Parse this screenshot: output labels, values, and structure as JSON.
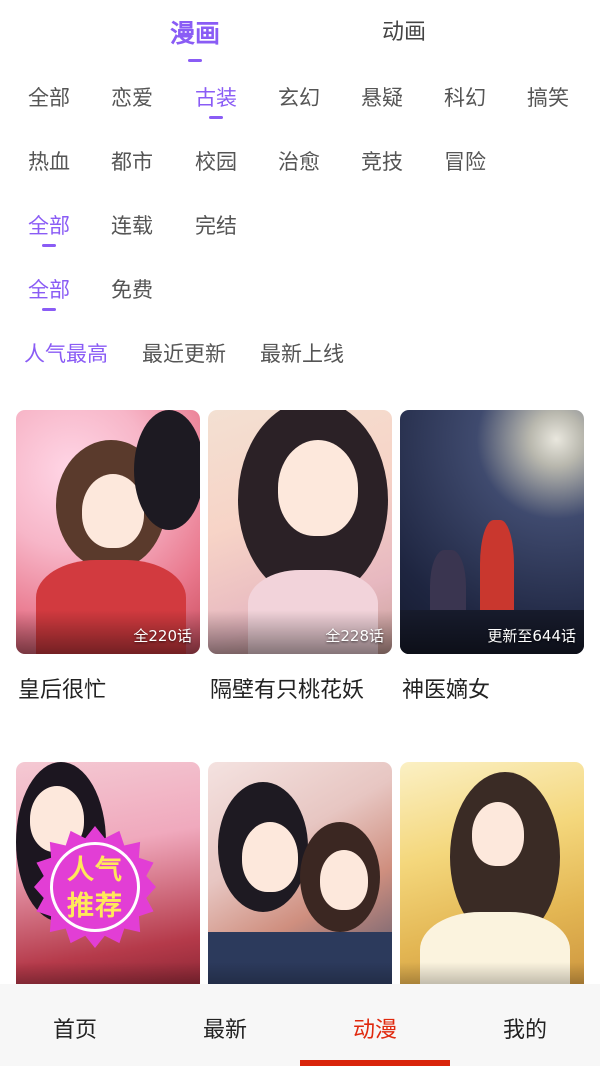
{
  "top_tabs": [
    {
      "label": "漫画",
      "active": true
    },
    {
      "label": "动画",
      "active": false
    }
  ],
  "genres_row1": [
    "全部",
    "恋爱",
    "古装",
    "玄幻",
    "悬疑",
    "科幻",
    "搞笑"
  ],
  "genres_row2": [
    "热血",
    "都市",
    "校园",
    "治愈",
    "竞技",
    "冒险"
  ],
  "status_filters": [
    "全部",
    "连载",
    "完结"
  ],
  "price_filters": [
    "全部",
    "免费"
  ],
  "sort_options": [
    "人气最高",
    "最近更新",
    "最新上线"
  ],
  "comics": [
    {
      "title": "皇后很忙",
      "episodes": "全220话"
    },
    {
      "title": "隔壁有只桃花妖",
      "episodes": "全228话"
    },
    {
      "title": "神医嫡女",
      "episodes": "更新至644话"
    }
  ],
  "badge": {
    "line1": "人气",
    "line2": "推荐"
  },
  "bottom_nav": [
    {
      "label": "首页",
      "active": false
    },
    {
      "label": "最新",
      "active": false
    },
    {
      "label": "动漫",
      "active": true
    },
    {
      "label": "我的",
      "active": false
    }
  ],
  "colors": {
    "accent": "#8a5cf5",
    "nav_active": "#e0290e"
  }
}
